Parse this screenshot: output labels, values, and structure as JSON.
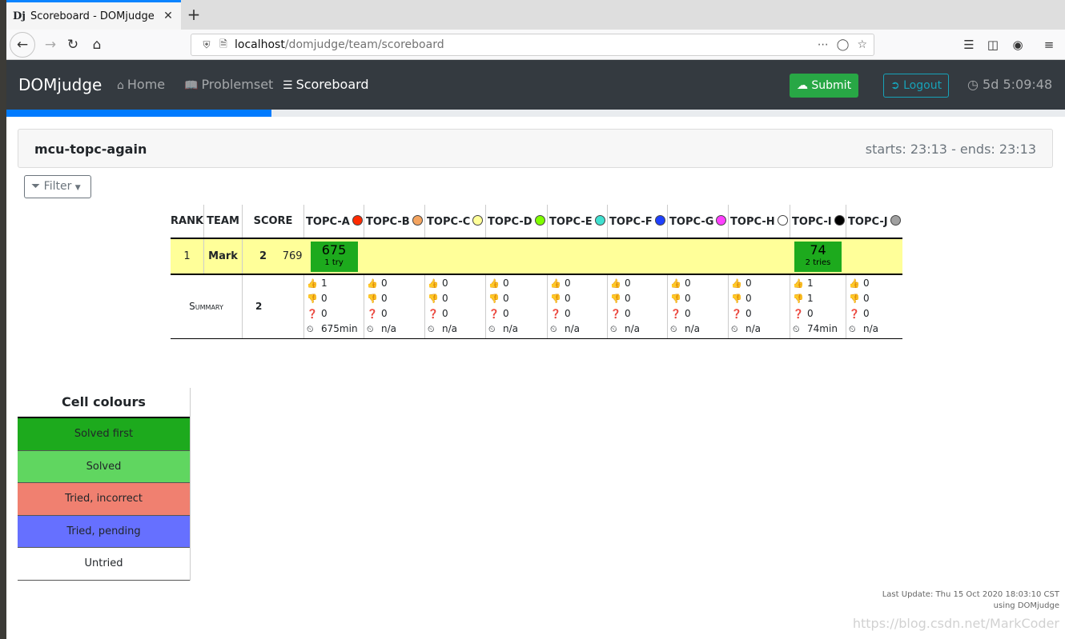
{
  "browser": {
    "tab_favicon": "Dj",
    "tab_title": "Scoreboard - DOMjudge",
    "tab_close": "✕",
    "new_tab": "+",
    "url_host": "localhost",
    "url_path": "/domjudge/team/scoreboard"
  },
  "site": {
    "brand": "DOMjudge",
    "menu": [
      {
        "label": "Home",
        "icon": "home-icon"
      },
      {
        "label": "Problemset",
        "icon": "book-icon"
      },
      {
        "label": "Scoreboard",
        "icon": "list-icon"
      }
    ],
    "submit_label": "Submit",
    "logout_label": "Logout",
    "countdown": "5d 5:09:48",
    "progress_fraction": 0.25
  },
  "contest": {
    "name": "mcu-topc-again",
    "times": "starts: 23:13 - ends: 23:13"
  },
  "filter_label": "Filter",
  "scoreboard": {
    "headers": {
      "rank": "RANK",
      "team": "TEAM",
      "score": "SCORE"
    },
    "problems": [
      {
        "label": "TOPC-A",
        "color": "#ff2a00"
      },
      {
        "label": "TOPC-B",
        "color": "#f4a460"
      },
      {
        "label": "TOPC-C",
        "color": "#ffff99"
      },
      {
        "label": "TOPC-D",
        "color": "#7fff00"
      },
      {
        "label": "TOPC-E",
        "color": "#40e0d0"
      },
      {
        "label": "TOPC-F",
        "color": "#1e40ff"
      },
      {
        "label": "TOPC-G",
        "color": "#ff40ff"
      },
      {
        "label": "TOPC-H",
        "color": "#ffffff"
      },
      {
        "label": "TOPC-I",
        "color": "#000000"
      },
      {
        "label": "TOPC-J",
        "color": "#a0a0a0"
      }
    ],
    "team_row": {
      "rank": "1",
      "team": "Mark",
      "solved": "2",
      "penalty": "769",
      "cells": [
        {
          "time": "675",
          "tries": "1 try"
        },
        null,
        null,
        null,
        null,
        null,
        null,
        null,
        {
          "time": "74",
          "tries": "2 tries"
        },
        null
      ]
    },
    "summary": {
      "label": "Summary",
      "solved": "2",
      "stats": [
        [
          "1",
          "0",
          "0",
          "675min"
        ],
        [
          "0",
          "0",
          "0",
          "n/a"
        ],
        [
          "0",
          "0",
          "0",
          "n/a"
        ],
        [
          "0",
          "0",
          "0",
          "n/a"
        ],
        [
          "0",
          "0",
          "0",
          "n/a"
        ],
        [
          "0",
          "0",
          "0",
          "n/a"
        ],
        [
          "0",
          "0",
          "0",
          "n/a"
        ],
        [
          "0",
          "0",
          "0",
          "n/a"
        ],
        [
          "1",
          "1",
          "0",
          "74min"
        ],
        [
          "0",
          "0",
          "0",
          "n/a"
        ]
      ]
    }
  },
  "legend": {
    "title": "Cell colours",
    "items": [
      {
        "label": "Solved first",
        "color": "#1daa1d"
      },
      {
        "label": "Solved",
        "color": "#60d660"
      },
      {
        "label": "Tried, incorrect",
        "color": "#f08070"
      },
      {
        "label": "Tried, pending",
        "color": "#6670ff"
      },
      {
        "label": "Untried",
        "color": "#ffffff"
      }
    ]
  },
  "footer": {
    "last_update": "Last Update: Thu 15 Oct 2020 18:03:10 CST",
    "using": "using DOMjudge"
  },
  "watermark": "https://blog.csdn.net/MarkCoder"
}
